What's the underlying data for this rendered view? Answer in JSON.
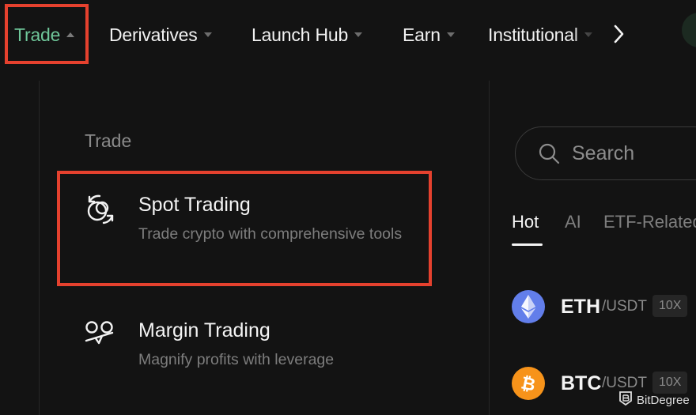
{
  "nav": {
    "items": [
      {
        "label": "Trade",
        "active": true
      },
      {
        "label": "Derivatives",
        "active": false
      },
      {
        "label": "Launch Hub",
        "active": false
      },
      {
        "label": "Earn",
        "active": false
      },
      {
        "label": "Institutional",
        "active": false
      }
    ]
  },
  "menu": {
    "section_title": "Trade",
    "items": [
      {
        "title": "Spot Trading",
        "description": "Trade crypto with comprehensive tools",
        "icon": "spot-trading-icon"
      },
      {
        "title": "Margin Trading",
        "description": "Magnify profits with leverage",
        "icon": "margin-trading-icon"
      }
    ]
  },
  "search": {
    "placeholder": "Search"
  },
  "tabs": [
    {
      "label": "Hot",
      "active": true
    },
    {
      "label": "AI",
      "active": false
    },
    {
      "label": "ETF-Related",
      "active": false
    }
  ],
  "coins": [
    {
      "symbol": "ETH",
      "quote": "/USDT",
      "leverage": "10X",
      "color": "#627eea"
    },
    {
      "symbol": "BTC",
      "quote": "/USDT",
      "leverage": "10X",
      "color": "#f7931a"
    }
  ],
  "watermark": {
    "text": "BitDegree"
  },
  "colors": {
    "accent_green": "#6fc79a",
    "highlight_red": "#e5412e",
    "background": "#131313"
  }
}
